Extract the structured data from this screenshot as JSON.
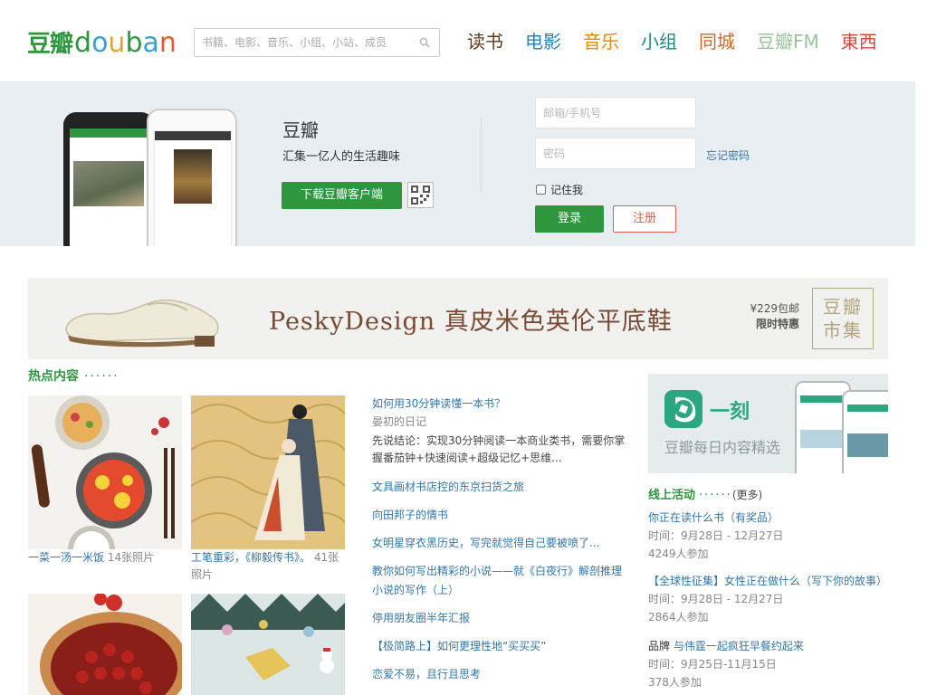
{
  "header": {
    "logo_cn": "豆瓣",
    "logo_en": [
      "d",
      "o",
      "u",
      "b",
      "a",
      "n"
    ],
    "search_placeholder": "书籍、电影、音乐、小组、小站、成员",
    "nav": [
      {
        "label": "读书",
        "color": "#5b3a1e"
      },
      {
        "label": "电影",
        "color": "#2384c6"
      },
      {
        "label": "音乐",
        "color": "#e68a00"
      },
      {
        "label": "小组",
        "color": "#1c8c7e"
      },
      {
        "label": "同城",
        "color": "#d9661a"
      },
      {
        "label": "豆瓣FM",
        "color": "#9ac29c"
      },
      {
        "label": "東西",
        "color": "#d84a3a"
      }
    ]
  },
  "hero": {
    "title": "豆瓣",
    "subtitle": "汇集一亿人的生活趣味",
    "download_label": "下载豆瓣客户端",
    "email_placeholder": "邮箱/手机号",
    "password_placeholder": "密码",
    "forgot_label": "忘记密码",
    "remember_label": "记住我",
    "login_label": "登录",
    "register_label": "注册"
  },
  "banner": {
    "title": "PeskyDesign 真皮米色英伦平底鞋",
    "price": "¥229包邮",
    "promo": "限时特惠",
    "market_line1": "豆瓣",
    "market_line2": "市集"
  },
  "hot": {
    "title": "热点内容",
    "dots": "······",
    "albums": [
      {
        "title": "一菜一汤一米饭",
        "count": "14张照片"
      },
      {
        "title": "工笔重彩，《柳毅传书》。",
        "count": "41张照片"
      }
    ],
    "articles": [
      {
        "title": "如何用30分钟读懂一本书？",
        "source": "晏初的日记",
        "desc": "先说结论：实现30分钟阅读一本商业类书，需要你掌握番茄钟+快速阅读+超级记忆+思维..."
      },
      {
        "title": "文具画材书店控的东京扫货之旅"
      },
      {
        "title": "向田邦子的情书"
      },
      {
        "title": "女明星穿衣黑历史，写完就觉得自己要被喷了..."
      },
      {
        "title": "教你如何写出精彩的小说——就《白夜行》解剖推理小说的写作（上）"
      },
      {
        "title": "停用朋友圈半年汇报"
      },
      {
        "title": "【极简路上】如何更理性地“买买买”"
      },
      {
        "title": "恋爱不易，且行且思考"
      }
    ]
  },
  "right": {
    "app_name": "一刻",
    "app_sub": "豆瓣每日内容精选",
    "activities_title": "线上活动",
    "activities_dots": "······",
    "more_label": "(更多)",
    "activities": [
      {
        "prefix": "",
        "title": "你正在读什么书（有奖品）",
        "time": "时间：9月28日 - 12月27日",
        "count": "4249人参加"
      },
      {
        "prefix": "",
        "title": "【全球性征集】女性正在做什么（写下你的故事）",
        "time": "时间：9月28日 - 12月27日",
        "count": "2864人参加"
      },
      {
        "prefix": "品牌 ",
        "title": "与伟霆一起疯狂早餐约起来",
        "time": "时间：9月25日-11月15日",
        "count": "378人参加"
      }
    ]
  }
}
